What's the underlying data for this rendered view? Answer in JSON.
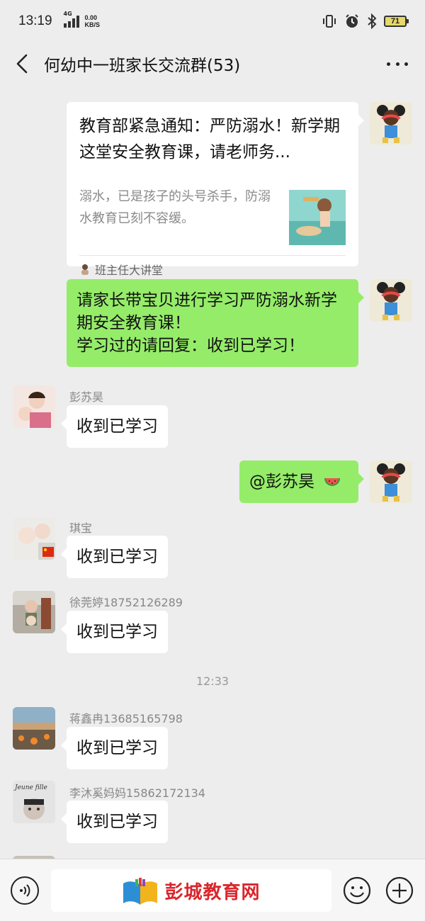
{
  "status_bar": {
    "time": "13:19",
    "network_type": "4G",
    "speed_value": "0.00",
    "speed_unit": "KB/S",
    "battery": "71"
  },
  "header": {
    "title": "何幼中一班家长交流群(53)"
  },
  "messages": {
    "card": {
      "title": "教育部紧急通知：严防溺水！新学期这堂安全教育课，请老师务...",
      "desc": "溺水，已是孩子的头号杀手，防溺水教育已刻不容缓。",
      "source": "班主任大讲堂"
    },
    "notice": {
      "text": "请家长带宝贝进行学习严防溺水新学期安全教育课！\n学习过的请回复：收到已学习！"
    },
    "reply1": {
      "sender": "彭苏昊",
      "text": "收到已学习"
    },
    "mention": {
      "text": "@彭苏昊"
    },
    "reply2": {
      "sender": "琪宝",
      "text": "收到已学习"
    },
    "reply3": {
      "sender": "徐莞婷18752126289",
      "text": "收到已学习"
    },
    "timestamp": "12:33",
    "reply4": {
      "sender": "蒋鑫冉13685165798",
      "text": "收到已学习"
    },
    "reply5": {
      "sender": "李沐奚妈妈15862172134",
      "text": "收到已学习",
      "avatar_text": "Jeune fille"
    }
  },
  "watermark": {
    "text": "彭城教育网"
  },
  "colors": {
    "background": "#ededed",
    "self_bubble": "#95ec69",
    "other_bubble": "#ffffff",
    "watermark": "#d9262c"
  },
  "icons": [
    "back-icon",
    "more-icon",
    "voice-icon",
    "emoji-icon",
    "plus-icon",
    "signal-icon",
    "vibrate-icon",
    "alarm-icon",
    "bluetooth-icon",
    "battery-icon",
    "watermelon-icon",
    "china-flag-icon"
  ]
}
